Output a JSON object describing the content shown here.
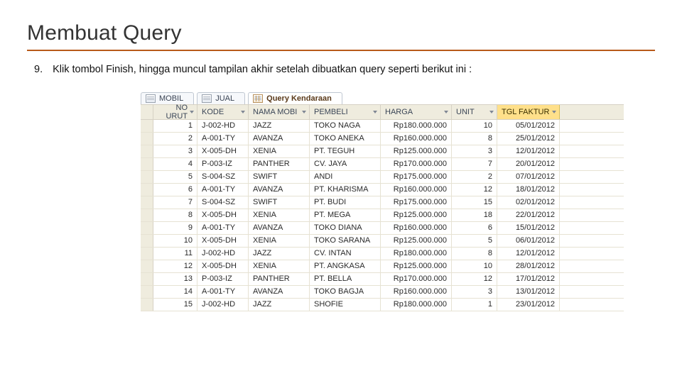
{
  "slide": {
    "title": "Membuat Query",
    "step_number": "9.",
    "step_text": "Klik tombol Finish, hingga muncul tampilan akhir setelah dibuatkan query seperti berikut ini :"
  },
  "tabs": [
    {
      "label": "MOBIL",
      "icon": "table",
      "active": false
    },
    {
      "label": "JUAL",
      "icon": "table",
      "active": false
    },
    {
      "label": "Query Kendaraan",
      "icon": "query",
      "active": true
    }
  ],
  "columns": [
    {
      "key": "no",
      "label": "NO URUT",
      "cls": "c-no",
      "align": "num"
    },
    {
      "key": "kode",
      "label": "KODE",
      "cls": "c-kode",
      "align": ""
    },
    {
      "key": "nama",
      "label": "NAMA MOBI",
      "cls": "c-nama",
      "align": ""
    },
    {
      "key": "pembeli",
      "label": "PEMBELI",
      "cls": "c-pemb",
      "align": ""
    },
    {
      "key": "harga",
      "label": "HARGA",
      "cls": "c-harga",
      "align": "num"
    },
    {
      "key": "unit",
      "label": "UNIT",
      "cls": "c-unit",
      "align": "num"
    },
    {
      "key": "tgl",
      "label": "TGL FAKTUR",
      "cls": "c-tgl",
      "align": "num",
      "active": true
    }
  ],
  "rows": [
    {
      "no": "1",
      "kode": "J-002-HD",
      "nama": "JAZZ",
      "pembeli": "TOKO NAGA",
      "harga": "Rp180.000.000",
      "unit": "10",
      "tgl": "05/01/2012"
    },
    {
      "no": "2",
      "kode": "A-001-TY",
      "nama": "AVANZA",
      "pembeli": "TOKO ANEKA",
      "harga": "Rp160.000.000",
      "unit": "8",
      "tgl": "25/01/2012"
    },
    {
      "no": "3",
      "kode": "X-005-DH",
      "nama": "XENIA",
      "pembeli": "PT. TEGUH",
      "harga": "Rp125.000.000",
      "unit": "3",
      "tgl": "12/01/2012"
    },
    {
      "no": "4",
      "kode": "P-003-IZ",
      "nama": "PANTHER",
      "pembeli": "CV. JAYA",
      "harga": "Rp170.000.000",
      "unit": "7",
      "tgl": "20/01/2012"
    },
    {
      "no": "5",
      "kode": "S-004-SZ",
      "nama": "SWIFT",
      "pembeli": "ANDI",
      "harga": "Rp175.000.000",
      "unit": "2",
      "tgl": "07/01/2012"
    },
    {
      "no": "6",
      "kode": "A-001-TY",
      "nama": "AVANZA",
      "pembeli": "PT. KHARISMA",
      "harga": "Rp160.000.000",
      "unit": "12",
      "tgl": "18/01/2012"
    },
    {
      "no": "7",
      "kode": "S-004-SZ",
      "nama": "SWIFT",
      "pembeli": "PT. BUDI",
      "harga": "Rp175.000.000",
      "unit": "15",
      "tgl": "02/01/2012"
    },
    {
      "no": "8",
      "kode": "X-005-DH",
      "nama": "XENIA",
      "pembeli": "PT. MEGA",
      "harga": "Rp125.000.000",
      "unit": "18",
      "tgl": "22/01/2012"
    },
    {
      "no": "9",
      "kode": "A-001-TY",
      "nama": "AVANZA",
      "pembeli": "TOKO DIANA",
      "harga": "Rp160.000.000",
      "unit": "6",
      "tgl": "15/01/2012"
    },
    {
      "no": "10",
      "kode": "X-005-DH",
      "nama": "XENIA",
      "pembeli": "TOKO SARANA",
      "harga": "Rp125.000.000",
      "unit": "5",
      "tgl": "06/01/2012"
    },
    {
      "no": "11",
      "kode": "J-002-HD",
      "nama": "JAZZ",
      "pembeli": "CV. INTAN",
      "harga": "Rp180.000.000",
      "unit": "8",
      "tgl": "12/01/2012"
    },
    {
      "no": "12",
      "kode": "X-005-DH",
      "nama": "XENIA",
      "pembeli": "PT. ANGKASA",
      "harga": "Rp125.000.000",
      "unit": "10",
      "tgl": "28/01/2012"
    },
    {
      "no": "13",
      "kode": "P-003-IZ",
      "nama": "PANTHER",
      "pembeli": "PT. BELLA",
      "harga": "Rp170.000.000",
      "unit": "12",
      "tgl": "17/01/2012"
    },
    {
      "no": "14",
      "kode": "A-001-TY",
      "nama": "AVANZA",
      "pembeli": "TOKO BAGJA",
      "harga": "Rp160.000.000",
      "unit": "3",
      "tgl": "13/01/2012"
    },
    {
      "no": "15",
      "kode": "J-002-HD",
      "nama": "JAZZ",
      "pembeli": "SHOFIE",
      "harga": "Rp180.000.000",
      "unit": "1",
      "tgl": "23/01/2012"
    }
  ]
}
